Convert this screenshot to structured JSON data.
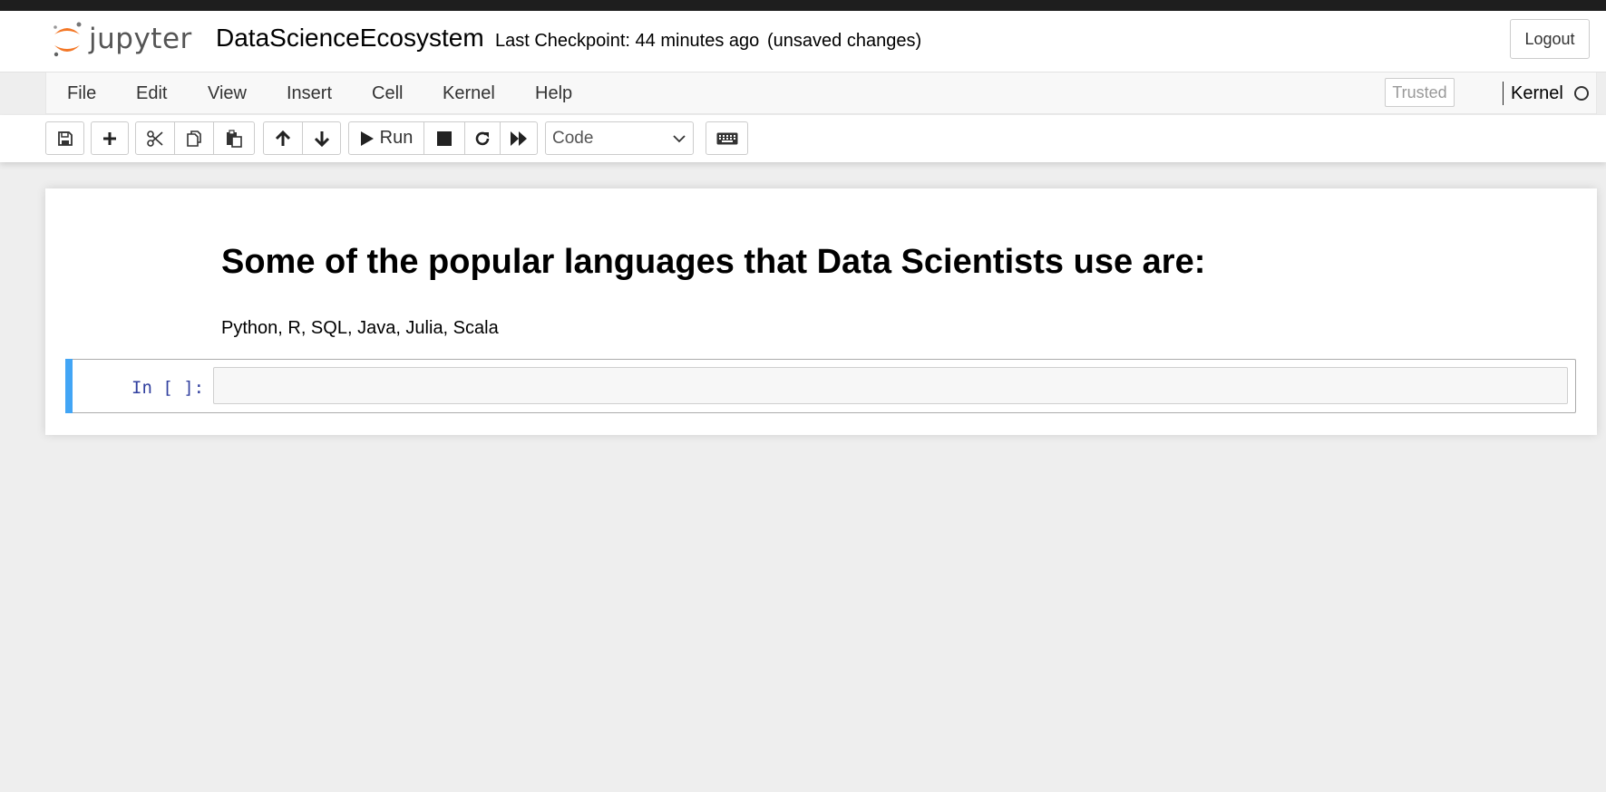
{
  "header": {
    "logo_text": "jupyter",
    "notebook_name": "DataScienceEcosystem",
    "checkpoint": "Last Checkpoint: 44 minutes ago",
    "save_status": "(unsaved changes)",
    "logout_label": "Logout"
  },
  "menubar": {
    "items": [
      "File",
      "Edit",
      "View",
      "Insert",
      "Cell",
      "Kernel",
      "Help"
    ],
    "trusted_label": "Trusted",
    "kernel_label": "Kernel"
  },
  "toolbar": {
    "run_label": "Run",
    "cell_type": "Code",
    "icons": [
      "save-icon",
      "plus-icon",
      "cut-icon",
      "copy-icon",
      "paste-icon",
      "arrow-up-icon",
      "arrow-down-icon",
      "play-icon",
      "stop-icon",
      "restart-icon",
      "fast-forward-icon",
      "keyboard-icon"
    ]
  },
  "notebook": {
    "markdown_heading": "Some of the popular languages that Data Scientists use are:",
    "markdown_text": "Python, R, SQL, Java, Julia, Scala",
    "code_prompt": "In [ ]:",
    "code_value": ""
  },
  "colors": {
    "accent_orange": "#f37726",
    "cell_selected_bar": "#42a5f5",
    "prompt_blue": "#303f9f",
    "background": "#eeeeee"
  }
}
